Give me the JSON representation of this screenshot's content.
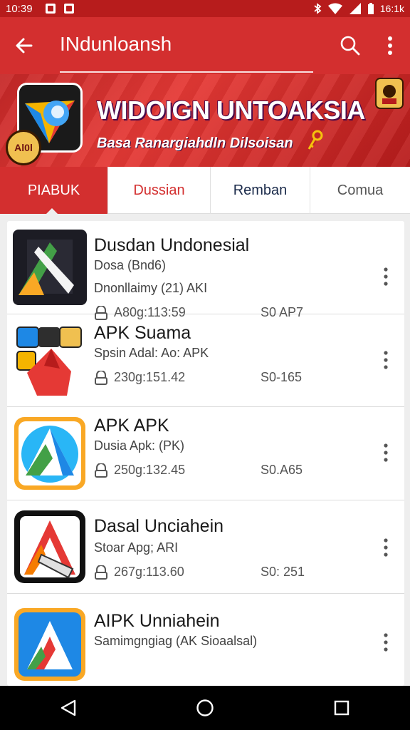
{
  "status_bar": {
    "time": "10:39",
    "clock_right": "16:1k",
    "icons": [
      "notification-icon",
      "mail-icon",
      "bluetooth-icon",
      "wifi-icon",
      "signal-icon",
      "battery-icon"
    ]
  },
  "app_bar": {
    "title": "INdunloansh"
  },
  "banner": {
    "title": "WIDOIGN UNTOAKSIA",
    "subtitle": "Basa Ranargiahdln Dilsoisan",
    "badge_text": "Al0l"
  },
  "tabs": [
    {
      "label": "PIABUK",
      "selected": true
    },
    {
      "label": "Dussian",
      "selected": false
    },
    {
      "label": "Remban",
      "selected": false
    },
    {
      "label": "Comua",
      "selected": false
    }
  ],
  "apps": [
    {
      "name": "Dusdan Undonesial",
      "sub": "Dosa (Bnd6)",
      "extra": "Dnonllaimy (21)  AKI",
      "stat": "A80g:113:59",
      "code": "S0 AP7"
    },
    {
      "name": "APK Suama",
      "sub": "Spsin Adal: Ao: APK",
      "extra": "",
      "stat": "230g:151.42",
      "code": "S0-165"
    },
    {
      "name": "APK APK",
      "sub": "Dusia Apk: (PK)",
      "extra": "",
      "stat": "250g:132.45",
      "code": "S0.A65"
    },
    {
      "name": "Dasal Unciahein",
      "sub": "Stoar Apg; ARI",
      "extra": "",
      "stat": "267g:113.60",
      "code": "S0: 251"
    },
    {
      "name": "AIPK Unniahein",
      "sub": "Samimgngiag (AK Sioaalsal)",
      "extra": "",
      "stat": "",
      "code": ""
    }
  ],
  "colors": {
    "primary": "#d32f2f",
    "primary_dark": "#b71c1c",
    "tab_text_active_alt": "#d32f2f"
  }
}
